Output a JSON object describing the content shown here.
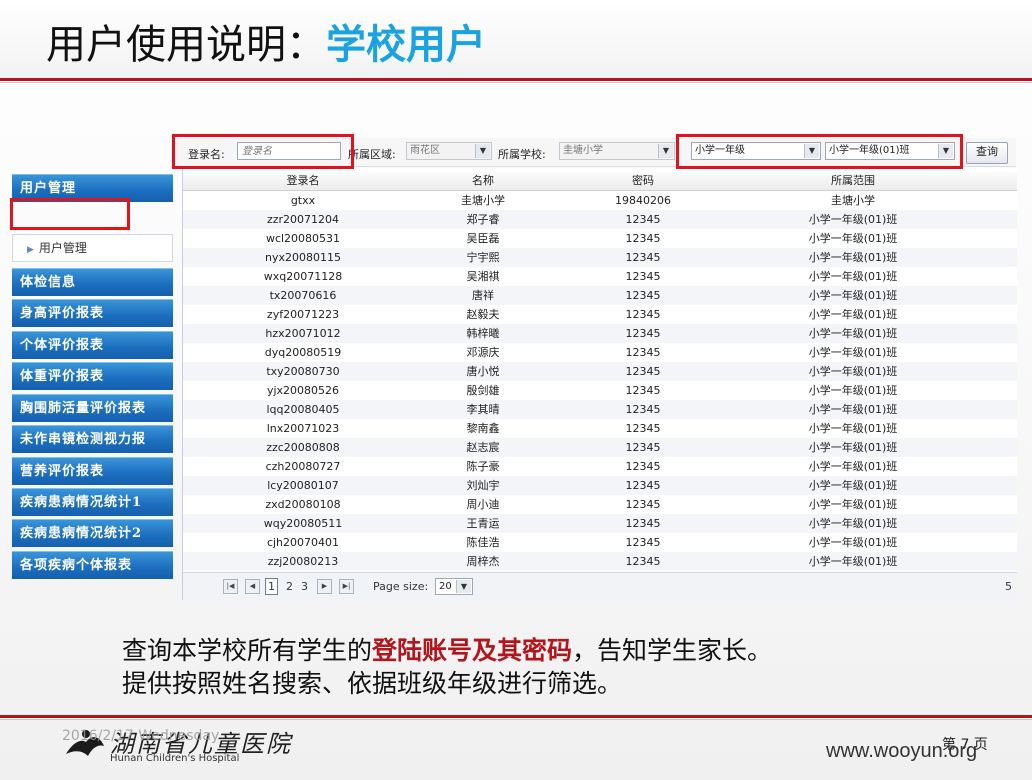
{
  "slide": {
    "title_prefix": "用户使用说明：",
    "title_highlight": "学校用户",
    "body_line1_a": "查询本学校所有学生的",
    "body_line1_em": "登陆账号及其密码",
    "body_line1_b": "，告知学生家长。",
    "body_line2": "提供按照姓名搜索、依据班级年级进行筛选。",
    "footer_date": "2016/2/17 Wednesday",
    "logo_cn": "湖南省儿童医院",
    "logo_en": "Hunan Children's Hospital",
    "page_label": "第 7 页",
    "watermark": "www.wooyun.org"
  },
  "search": {
    "login_label": "登录名:",
    "login_placeholder": "登录名",
    "region_label": "所属区域:",
    "region_value": "雨花区",
    "school_label": "所属学校:",
    "school_value": "圭塘小学",
    "grade_value": "小学一年级",
    "class_value": "小学一年级(01)班",
    "query_label": "查询"
  },
  "sidebar": {
    "groups": [
      {
        "label": "用户管理"
      },
      {
        "label": "体检信息"
      },
      {
        "label": "身高评价报表"
      },
      {
        "label": "个体评价报表"
      },
      {
        "label": "体重评价报表"
      },
      {
        "label": "胸围肺活量评价报表"
      },
      {
        "label": "未作串镜检测视力报"
      },
      {
        "label": "营养评价报表"
      },
      {
        "label": "疾病患病情况统计1"
      },
      {
        "label": "疾病患病情况统计2"
      },
      {
        "label": "各项疾病个体报表"
      }
    ],
    "sub_item": "用户管理"
  },
  "grid": {
    "columns": [
      "登录名",
      "名称",
      "密码",
      "所属范围"
    ],
    "rows": [
      [
        "gtxx",
        "圭塘小学",
        "19840206",
        "圭塘小学"
      ],
      [
        "zzr20071204",
        "郑子睿",
        "12345",
        "小学一年级(01)班"
      ],
      [
        "wcl20080531",
        "吴臣磊",
        "12345",
        "小学一年级(01)班"
      ],
      [
        "nyx20080115",
        "宁宇熙",
        "12345",
        "小学一年级(01)班"
      ],
      [
        "wxq20071128",
        "吴湘祺",
        "12345",
        "小学一年级(01)班"
      ],
      [
        "tx20070616",
        "唐祥",
        "12345",
        "小学一年级(01)班"
      ],
      [
        "zyf20071223",
        "赵毅夫",
        "12345",
        "小学一年级(01)班"
      ],
      [
        "hzx20071012",
        "韩梓曦",
        "12345",
        "小学一年级(01)班"
      ],
      [
        "dyq20080519",
        "邓源庆",
        "12345",
        "小学一年级(01)班"
      ],
      [
        "txy20080730",
        "唐小悦",
        "12345",
        "小学一年级(01)班"
      ],
      [
        "yjx20080526",
        "殷剑雄",
        "12345",
        "小学一年级(01)班"
      ],
      [
        "lqq20080405",
        "李其晴",
        "12345",
        "小学一年级(01)班"
      ],
      [
        "lnx20071023",
        "黎南鑫",
        "12345",
        "小学一年级(01)班"
      ],
      [
        "zzc20080808",
        "赵志宸",
        "12345",
        "小学一年级(01)班"
      ],
      [
        "czh20080727",
        "陈子豪",
        "12345",
        "小学一年级(01)班"
      ],
      [
        "lcy20080107",
        "刘灿宇",
        "12345",
        "小学一年级(01)班"
      ],
      [
        "zxd20080108",
        "周小迪",
        "12345",
        "小学一年级(01)班"
      ],
      [
        "wqy20080511",
        "王青运",
        "12345",
        "小学一年级(01)班"
      ],
      [
        "cjh20070401",
        "陈佳浩",
        "12345",
        "小学一年级(01)班"
      ],
      [
        "zzj20080213",
        "周梓杰",
        "12345",
        "小学一年级(01)班"
      ]
    ]
  },
  "pager": {
    "pages": [
      "1",
      "2",
      "3"
    ],
    "current": "1",
    "size_label": "Page size:",
    "size_value": "20",
    "right_count": "5"
  },
  "colors": {
    "accent_red": "#b2151c",
    "highlight_red": "#e0151c",
    "title_blue": "#1aa3e0",
    "nav_blue": "#1d6fc0"
  }
}
